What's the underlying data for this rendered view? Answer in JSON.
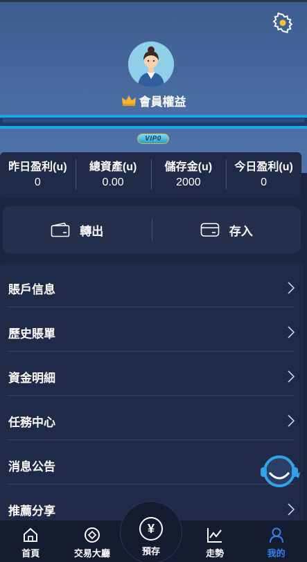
{
  "header": {
    "member_label": "會員權益",
    "vip_badge": "VIP0"
  },
  "stats": [
    {
      "label": "昨日盈利(u)",
      "value": "0"
    },
    {
      "label": "總資產(u)",
      "value": "0.00"
    },
    {
      "label": "儲存金(u)",
      "value": "2000"
    },
    {
      "label": "今日盈利(u)",
      "value": "0"
    }
  ],
  "actions": {
    "transfer_out": "轉出",
    "deposit": "存入"
  },
  "menu": [
    {
      "label": "賬戶信息"
    },
    {
      "label": "歷史賬單"
    },
    {
      "label": "資金明細"
    },
    {
      "label": "任務中心"
    },
    {
      "label": "消息公告"
    },
    {
      "label": "推薦分享"
    }
  ],
  "tabbar": {
    "home": "首頁",
    "trading_hall": "交易大廳",
    "center_symbol": "¥",
    "center": "預存",
    "trend": "走勢",
    "mine": "我的"
  },
  "colors": {
    "header_bg": "#4a6da3",
    "page_bg": "#1b2540",
    "accent": "#3a7cf0",
    "progress": "#1aa6e8"
  }
}
